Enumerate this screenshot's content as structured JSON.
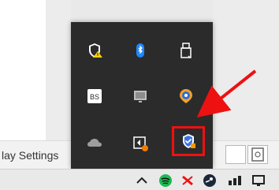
{
  "settings": {
    "label": "lay Settings"
  },
  "tray_icons": [
    {
      "name": "security-shield-warning-icon"
    },
    {
      "name": "bluetooth-icon"
    },
    {
      "name": "usb-drive-icon"
    },
    {
      "name": "bs-app-icon"
    },
    {
      "name": "display-icon"
    },
    {
      "name": "location-pin-icon"
    },
    {
      "name": "cloud-icon"
    },
    {
      "name": "remote-device-icon"
    },
    {
      "name": "defender-icon"
    }
  ],
  "taskbar": {
    "icons": [
      {
        "name": "chevron-up-icon"
      },
      {
        "name": "spotify-icon"
      },
      {
        "name": "red-app-icon"
      },
      {
        "name": "steam-icon"
      },
      {
        "name": "network-icon"
      },
      {
        "name": "screen-icon"
      }
    ]
  },
  "colors": {
    "tray_bg": "#2b2b2b",
    "highlight": "#e11",
    "arrow": "#e11"
  }
}
